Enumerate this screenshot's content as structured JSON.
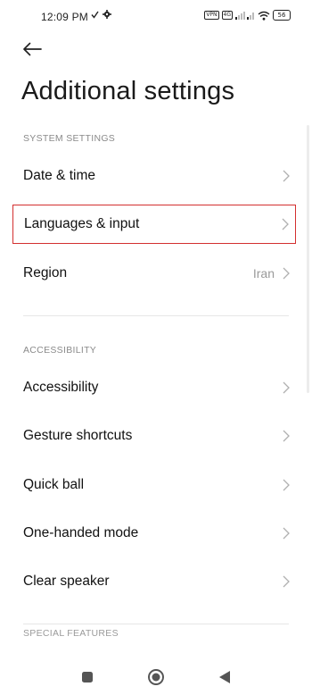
{
  "status_bar": {
    "time": "12:09 PM",
    "tags": [
      "VPN",
      "4G"
    ],
    "battery": "56"
  },
  "header": {
    "title": "Additional settings"
  },
  "sections": [
    {
      "header": "SYSTEM SETTINGS",
      "items": [
        {
          "label": "Date & time",
          "value": ""
        },
        {
          "label": "Languages & input",
          "value": "",
          "highlighted": true
        },
        {
          "label": "Region",
          "value": "Iran"
        }
      ]
    },
    {
      "header": "ACCESSIBILITY",
      "items": [
        {
          "label": "Accessibility",
          "value": ""
        },
        {
          "label": "Gesture shortcuts",
          "value": ""
        },
        {
          "label": "Quick ball",
          "value": ""
        },
        {
          "label": "One-handed mode",
          "value": ""
        },
        {
          "label": "Clear speaker",
          "value": ""
        }
      ]
    },
    {
      "header": "SPECIAL FEATURES"
    }
  ],
  "colors": {
    "highlight": "#d32f2f",
    "section_header": "#8a8a8a",
    "value_text": "#9a9a9a"
  },
  "icons": {
    "back": "arrow-left-icon",
    "chevron": "chevron-right-icon",
    "nav_recents": "square-icon",
    "nav_home": "circle-icon",
    "nav_back": "triangle-back-icon"
  }
}
